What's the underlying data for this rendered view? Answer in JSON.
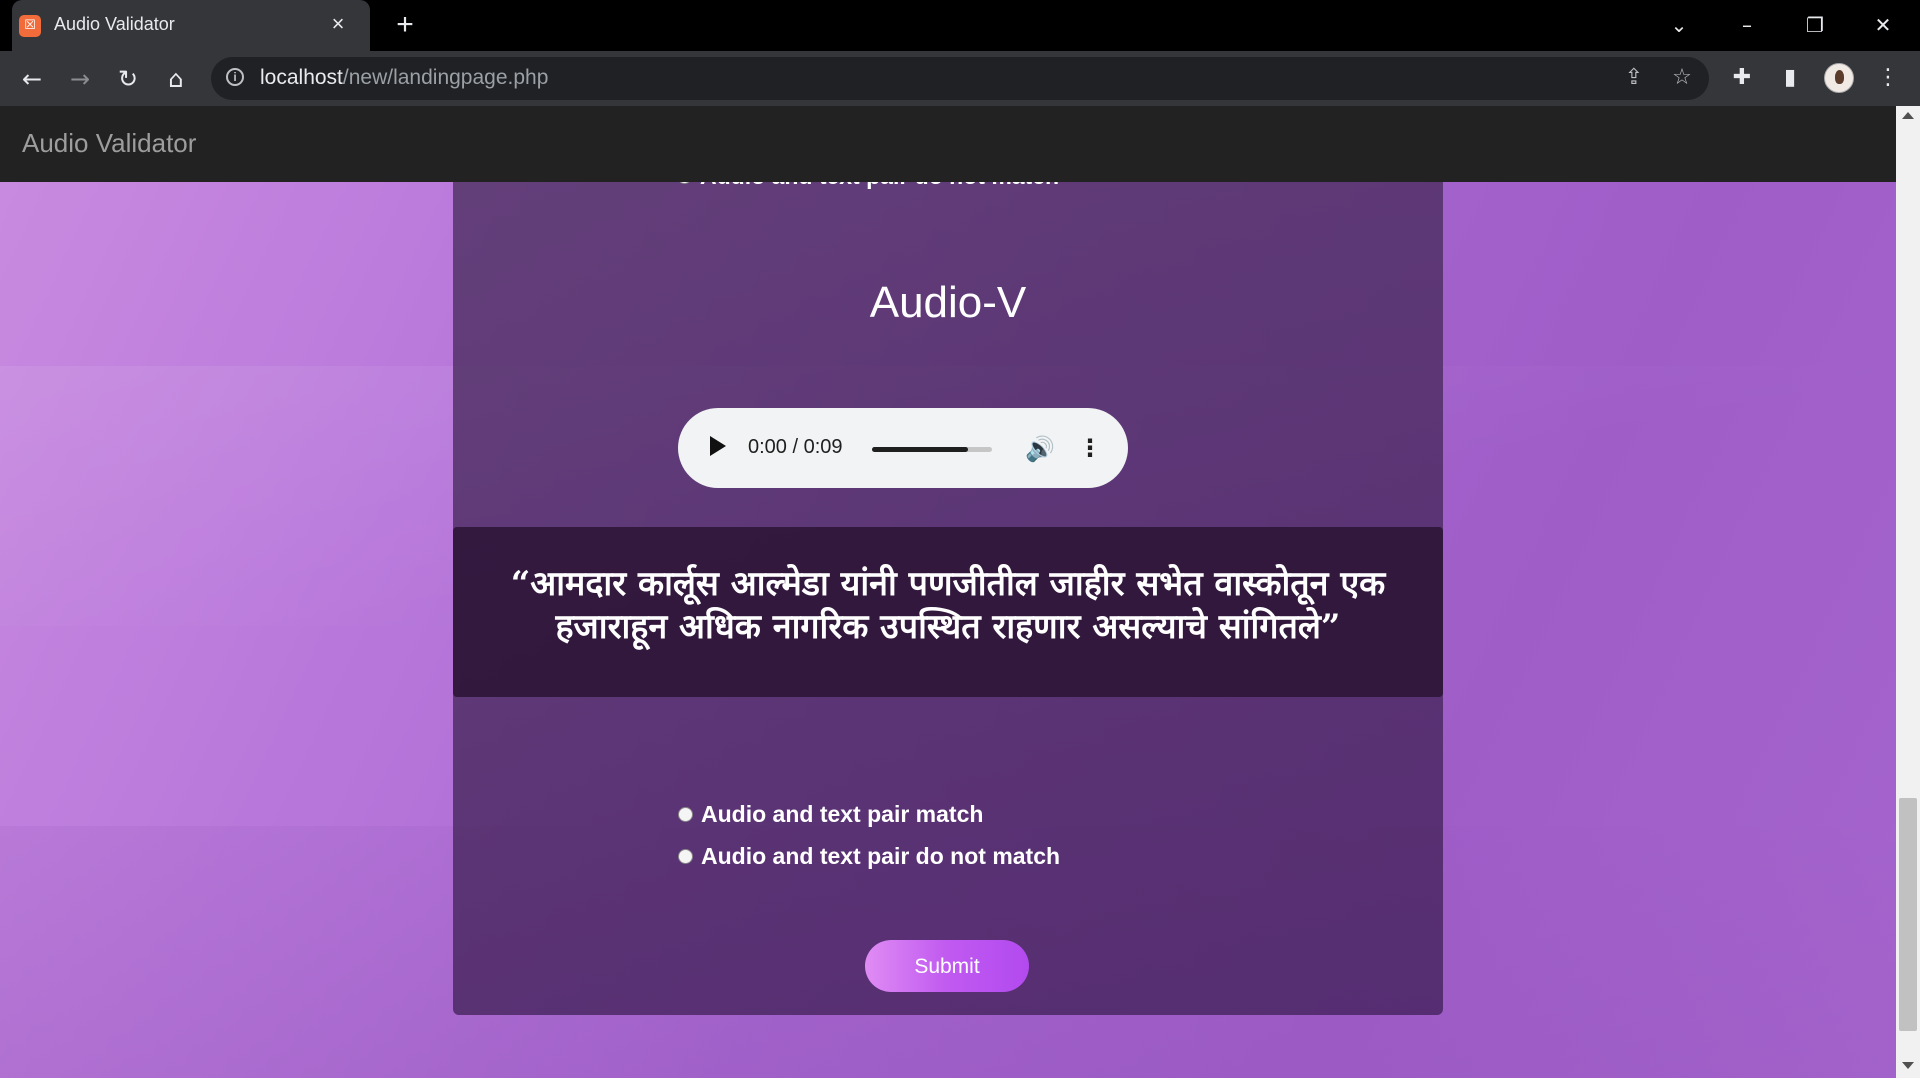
{
  "browser": {
    "tab_title": "Audio Validator",
    "tab_favicon": "xampp-icon",
    "url_host": "localhost",
    "url_path": "/new/landingpage.php"
  },
  "page": {
    "brand": "Audio Validator",
    "title_partial_top": "Audio and text pair do not match",
    "app_title": "Audio-V",
    "player": {
      "time": "0:00 / 0:09",
      "progress": 0.8
    },
    "quote": "“आमदार कार्लूस आल्मेडा यांनी पणजीतील जाहीर सभेत वास्कोतून एक हजाराहून अधिक नागरिक उपस्थित राहणार असल्याचे सांगितले”",
    "options": [
      "Audio and text pair match",
      "Audio and text pair do not match"
    ],
    "submit_label": "Submit"
  },
  "colors": {
    "navbar": "#222222",
    "accent_button": "#c05af0",
    "background": "#b070d8"
  }
}
